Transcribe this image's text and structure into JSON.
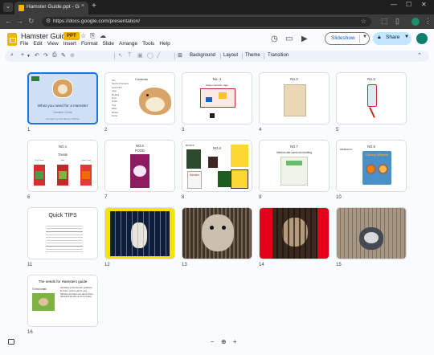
{
  "browser": {
    "tab_title": "Hamster Guide.ppt - Google Sli",
    "url": "https://docs.google.com/presentation/",
    "new_tab_label": "+",
    "close_tab_label": "×"
  },
  "app": {
    "doc_title": "Hamster Guide",
    "file_badge": "PPT",
    "menu": [
      "File",
      "Edit",
      "View",
      "Insert",
      "Format",
      "Slide",
      "Arrange",
      "Tools",
      "Help"
    ],
    "slideshow_label": "Slideshow",
    "share_label": "Share",
    "toolbar_buttons": [
      "Background",
      "Layout",
      "Theme",
      "Transition"
    ],
    "colors": {
      "accent": "#1a73e8",
      "share_bg": "#c2e7ff",
      "badge": "#f4b400"
    }
  },
  "slides": [
    {
      "number": "1",
      "title": "What you need for a Hamster",
      "subtitle": "Hamster Guide",
      "footer": "A project by the Harvey children"
    },
    {
      "number": "2",
      "title": "Contents",
      "items": [
        "Title",
        "Need for Hamsters",
        "Quick TIPS",
        "Cage",
        "Bedding",
        "Food",
        "Treats",
        "Toys",
        "Water",
        "Wheels",
        "Extras"
      ]
    },
    {
      "number": "3",
      "title": "No. 1",
      "caption": "Happy hamster cage"
    },
    {
      "number": "4",
      "title": "No.2"
    },
    {
      "number": "5",
      "title": "No.3"
    },
    {
      "number": "6",
      "title": "NO.4",
      "caption": "Treats",
      "labels": [
        "Fruit Treats",
        "Nuts",
        "Carrot Treat"
      ]
    },
    {
      "number": "7",
      "title": "NO.5",
      "caption": "FOOD"
    },
    {
      "number": "8",
      "title": "NO.6",
      "caption": "BOOKS",
      "book_label": "Hamster"
    },
    {
      "number": "9",
      "title": "NO.7",
      "caption": "Medium alle sized use bedding"
    },
    {
      "number": "10",
      "title": "NO.8",
      "caption": "MINERALS",
      "product": "Chewy Wheels"
    },
    {
      "number": "11",
      "title": "Quick TIPS"
    },
    {
      "number": "12"
    },
    {
      "number": "13"
    },
    {
      "number": "14"
    },
    {
      "number": "15"
    },
    {
      "number": "16",
      "title": "The needs for Hamsters guide",
      "caption": "To find small",
      "body": "Hamsters is the hamster guidance for them. Look to get for your hamster and have new about home. Hamsters are fine up to 2-3 years."
    }
  ]
}
